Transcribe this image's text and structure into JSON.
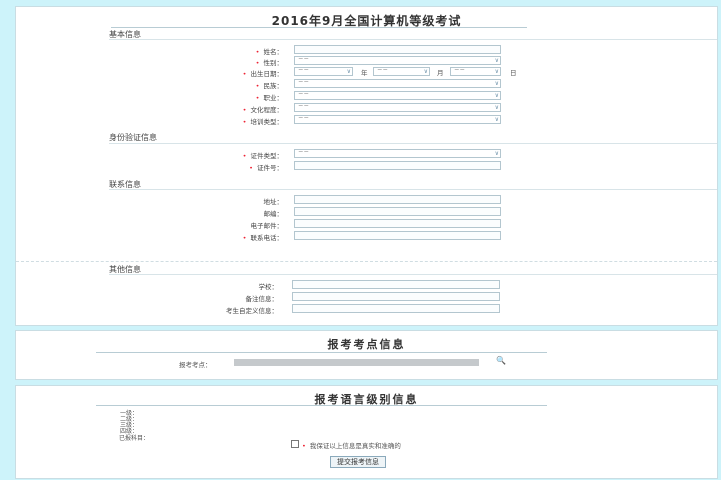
{
  "title": "2016年9月全国计算机等级考试",
  "sections": {
    "basic": "基本信息",
    "id": "身份验证信息",
    "contact": "联系信息",
    "other": "其他信息"
  },
  "basic_fields": {
    "name": "姓名：",
    "gender": "性别：",
    "birth": "出生日期：",
    "ethnicity": "民族：",
    "occupation": "职业：",
    "education": "文化程度：",
    "training": "培训类型："
  },
  "select_placeholder": "－－",
  "date_units": {
    "year": "年",
    "month": "月",
    "day": "日"
  },
  "id_fields": {
    "doc_type": "证件类型：",
    "doc_no": "证件号："
  },
  "contact_fields": {
    "address": "地址：",
    "postcode": "邮编：",
    "email": "电子邮件：",
    "phone": "联系电话："
  },
  "other_fields": {
    "school": "学校：",
    "remark": "备注信息：",
    "custom": "考生自定义信息："
  },
  "venue": {
    "title": "报考考点信息",
    "label": "报考考点："
  },
  "language": {
    "title": "报考语言级别信息",
    "levels": [
      "一级：",
      "二级：",
      "三级：",
      "四级："
    ],
    "selected_label": "已报科目：",
    "confirm_text": "我保证以上信息是真实和准确的",
    "submit": "提交报考信息"
  }
}
